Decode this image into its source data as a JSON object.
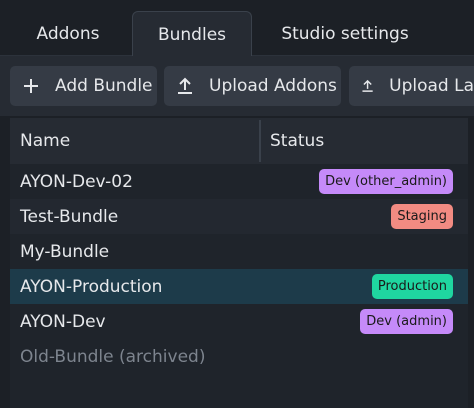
{
  "tabs": [
    {
      "label": "Addons",
      "active": false
    },
    {
      "label": "Bundles",
      "active": true
    },
    {
      "label": "Studio settings",
      "active": false
    }
  ],
  "toolbar": {
    "add_bundle": {
      "label": "Add Bundle",
      "icon": "plus-icon"
    },
    "upload_addons": {
      "label": "Upload Addons",
      "icon": "upload-icon"
    },
    "upload_launcher": {
      "label": "Upload La",
      "icon": "upload-icon"
    }
  },
  "table": {
    "columns": [
      "Name",
      "Status"
    ],
    "rows": [
      {
        "name": "AYON-Dev-02",
        "status": "Dev (other_admin)",
        "status_color": "#c58af9"
      },
      {
        "name": "Test-Bundle",
        "status": "Staging",
        "status_color": "#f28b82"
      },
      {
        "name": "My-Bundle",
        "status": "",
        "status_color": ""
      },
      {
        "name": "AYON-Production",
        "status": "Production",
        "status_color": "#1fd6a0",
        "selected": true
      },
      {
        "name": "AYON-Dev",
        "status": "Dev (admin)",
        "status_color": "#c58af9"
      },
      {
        "name": "Old-Bundle (archived)",
        "status": "",
        "status_color": "",
        "archived": true
      }
    ]
  },
  "colors": {
    "background": "#1c2026",
    "panel": "#262b33",
    "selected_row": "#1d3b4a"
  }
}
